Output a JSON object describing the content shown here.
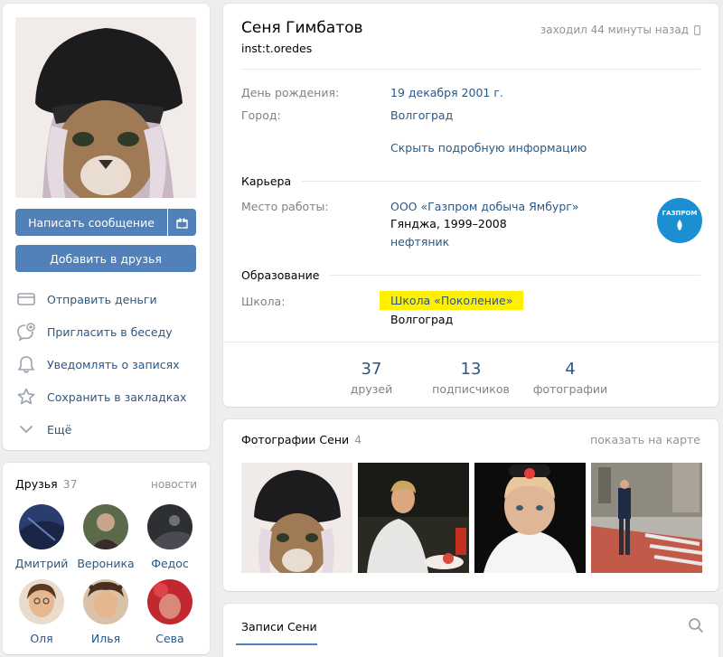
{
  "profile": {
    "name": "Сеня Гимбатов",
    "status": "inst:t.oredes",
    "online": "заходил 44 минуты назад",
    "birthday_label": "День рождения:",
    "birthday_value": "19 декабря 2001 г.",
    "city_label": "Город:",
    "city_value": "Волгоград",
    "hide_details": "Скрыть подробную информацию",
    "career_title": "Карьера",
    "work_label": "Место работы:",
    "work_company": "ООО «Газпром добыча Ямбург»",
    "work_place": "Гянджа, 1999–2008",
    "work_position": "нефтяник",
    "company_logo_text": "ГАЗПРОМ",
    "education_title": "Образование",
    "school_label": "Школа:",
    "school_name": "Школа «Поколение»",
    "school_city": "Волгоград"
  },
  "counters": [
    {
      "num": "37",
      "label": "друзей"
    },
    {
      "num": "13",
      "label": "подписчиков"
    },
    {
      "num": "4",
      "label": "фотографии"
    }
  ],
  "actions": {
    "send_message": "Написать сообщение",
    "add_friend": "Добавить в друзья",
    "list": [
      {
        "label": "Отправить деньги",
        "icon": "card-icon"
      },
      {
        "label": "Пригласить в беседу",
        "icon": "chat-plus-icon"
      },
      {
        "label": "Уведомлять о записях",
        "icon": "bell-icon"
      },
      {
        "label": "Сохранить в закладках",
        "icon": "star-icon"
      },
      {
        "label": "Ещё",
        "icon": "chevron-down-icon"
      }
    ]
  },
  "friends": {
    "title": "Друзья",
    "count": "37",
    "news": "новости",
    "items": [
      {
        "name": "Дмитрий",
        "color": "#2b3d6e"
      },
      {
        "name": "Вероника",
        "color": "#5b6a4a"
      },
      {
        "name": "Федос",
        "color": "#2e2f33"
      },
      {
        "name": "Оля",
        "color": "#c98f5a"
      },
      {
        "name": "Илья",
        "color": "#b98e6d"
      },
      {
        "name": "Сева",
        "color": "#c2282f"
      }
    ]
  },
  "photos": {
    "title": "Фотографии Сени",
    "count": "4",
    "map_link": "показать на карте"
  },
  "posts": {
    "tab": "Записи Сени"
  },
  "colors": {
    "accent": "#5181b8",
    "link": "#2a5885",
    "highlight": "#ffef00",
    "background": "#edeef0"
  }
}
